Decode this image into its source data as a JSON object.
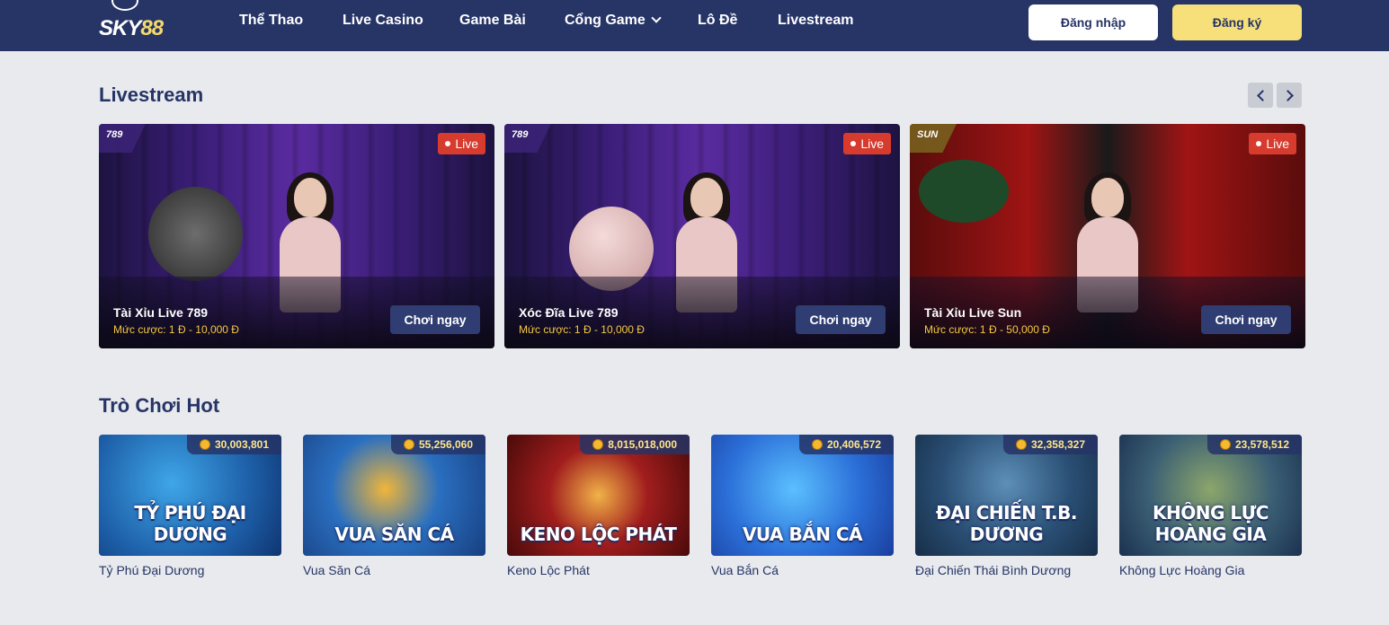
{
  "header": {
    "logo": {
      "text_white": "SKY",
      "text_yellow": "88"
    },
    "nav": [
      "Thể Thao",
      "Live Casino",
      "Game Bài",
      "Cổng Game",
      "Lô Đề",
      "Livestream"
    ],
    "login_label": "Đăng nhập",
    "register_label": "Đăng ký"
  },
  "colors": {
    "header_bg": "#263466",
    "accent_yellow": "#f7e07a",
    "live_red": "#d63b2e",
    "bet_yellow": "#f5c842"
  },
  "livestream": {
    "title": "Livestream",
    "cards": [
      {
        "brand": "789",
        "badge": "Live",
        "title": "Tài Xỉu Live 789",
        "bet": "Mức cược: 1 Đ - 10,000 Đ",
        "button": "Chơi ngay"
      },
      {
        "brand": "789",
        "badge": "Live",
        "title": "Xóc Đĩa Live 789",
        "bet": "Mức cược: 1 Đ - 10,000 Đ",
        "button": "Chơi ngay"
      },
      {
        "brand": "SUN",
        "badge": "Live",
        "title": "Tài Xỉu Live Sun",
        "bet": "Mức cược: 1 Đ - 50,000 Đ",
        "button": "Chơi ngay"
      }
    ]
  },
  "hot_games": {
    "title": "Trò Chơi Hot",
    "games": [
      {
        "jackpot": "30,003,801",
        "art_title": "TỶ PHÚ ĐẠI DƯƠNG",
        "name": "Tỷ Phú Đại Dương"
      },
      {
        "jackpot": "55,256,060",
        "art_title": "VUA SĂN CÁ",
        "name": "Vua Săn Cá"
      },
      {
        "jackpot": "8,015,018,000",
        "art_title": "KENO LỘC PHÁT",
        "name": "Keno Lộc Phát"
      },
      {
        "jackpot": "20,406,572",
        "art_title": "VUA BẮN CÁ",
        "name": "Vua Bắn Cá"
      },
      {
        "jackpot": "32,358,327",
        "art_title": "ĐẠI CHIẾN T.B. DƯƠNG",
        "name": "Đại Chiến Thái Bình Dương"
      },
      {
        "jackpot": "23,578,512",
        "art_title": "KHÔNG LỰC HOÀNG GIA",
        "name": "Không Lực Hoàng Gia"
      }
    ]
  }
}
